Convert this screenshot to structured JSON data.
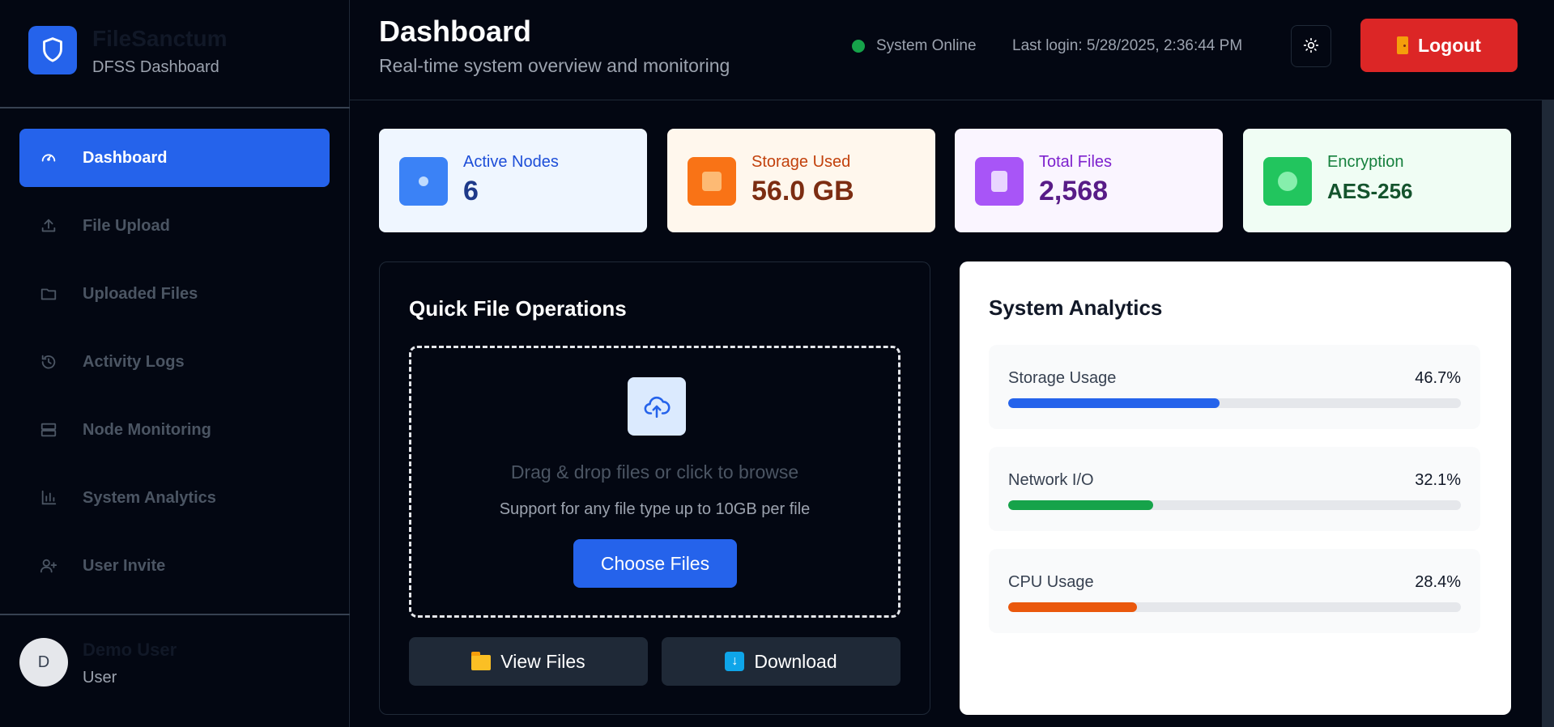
{
  "brand": {
    "name": "FileSanctum",
    "subtitle": "DFSS Dashboard",
    "logo_icon": "shield-icon"
  },
  "sidebar": {
    "items": [
      {
        "label": "Dashboard",
        "icon": "gauge-icon",
        "active": true
      },
      {
        "label": "File Upload",
        "icon": "upload-icon"
      },
      {
        "label": "Uploaded Files",
        "icon": "folder-icon"
      },
      {
        "label": "Activity Logs",
        "icon": "history-icon"
      },
      {
        "label": "Node Monitoring",
        "icon": "server-icon"
      },
      {
        "label": "System Analytics",
        "icon": "bar-chart-icon"
      },
      {
        "label": "User Invite",
        "icon": "user-plus-icon"
      }
    ],
    "user": {
      "initial": "D",
      "name": "Demo User",
      "role": "User"
    }
  },
  "header": {
    "title": "Dashboard",
    "subtitle": "Real-time system overview and monitoring",
    "status": "System Online",
    "last_login": "Last login: 5/28/2025, 2:36:44 PM",
    "theme_icon": "sun-icon",
    "logout_label": "Logout"
  },
  "stats": [
    {
      "label": "Active Nodes",
      "value": "6",
      "bg": "#eff6ff",
      "icon_bg": "#3b82f6",
      "label_color": "#1d4ed8",
      "value_color": "#1e3a8a"
    },
    {
      "label": "Storage Used",
      "value": "56.0 GB",
      "bg": "#fff7ed",
      "icon_bg": "#f97316",
      "label_color": "#c2410c",
      "value_color": "#7c2d12"
    },
    {
      "label": "Total Files",
      "value": "2,568",
      "bg": "#faf5ff",
      "icon_bg": "#a855f7",
      "label_color": "#7e22ce",
      "value_color": "#581c87"
    },
    {
      "label": "Encryption",
      "value": "AES-256",
      "bg": "#f0fdf4",
      "icon_bg": "#22c55e",
      "label_color": "#15803d",
      "value_color": "#14532d"
    }
  ],
  "operations": {
    "title": "Quick File Operations",
    "drop_text": "Drag & drop files or click to browse",
    "drop_sub": "Support for any file type up to 10GB per file",
    "choose_label": "Choose Files",
    "view_label": "View Files",
    "download_label": "Download"
  },
  "analytics": {
    "title": "System Analytics",
    "metrics": [
      {
        "label": "Storage Usage",
        "value": "46.7%",
        "percent": 46.7,
        "color": "#2563eb"
      },
      {
        "label": "Network I/O",
        "value": "32.1%",
        "percent": 32.1,
        "color": "#16a34a"
      },
      {
        "label": "CPU Usage",
        "value": "28.4%",
        "percent": 28.4,
        "color": "#ea580c"
      }
    ]
  }
}
